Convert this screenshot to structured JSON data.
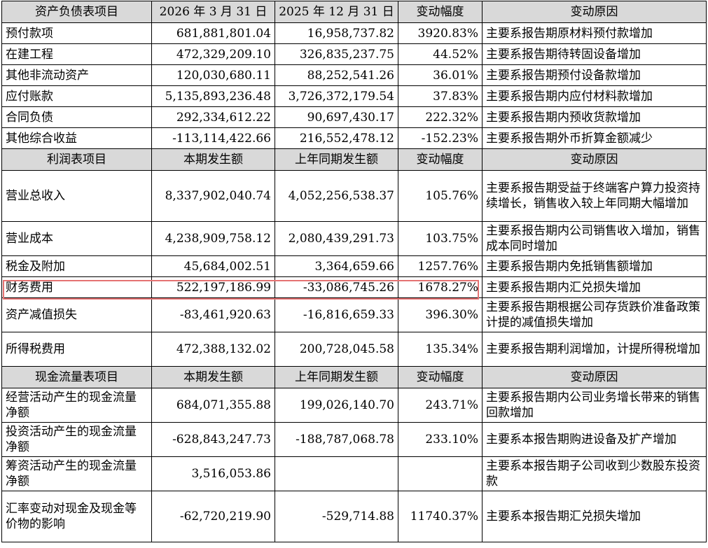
{
  "sections": {
    "balance": {
      "header": [
        "资产负债表项目",
        "2026 年 3 月 31 日",
        "2025 年 12 月 31 日",
        "变动幅度",
        "变动原因"
      ],
      "rows": [
        {
          "item": "预付款项",
          "a": "681,881,801.04",
          "b": "16,958,737.82",
          "pct": "3920.83%",
          "reason": "主要系报告期原材料预付款增加"
        },
        {
          "item": "在建工程",
          "a": "472,329,209.10",
          "b": "326,835,237.75",
          "pct": "44.52%",
          "reason": "主要系报告期待转固设备增加"
        },
        {
          "item": "其他非流动资产",
          "a": "120,030,680.11",
          "b": "88,252,541.26",
          "pct": "36.01%",
          "reason": "主要系报告期预付设备款增加"
        },
        {
          "item": "应付账款",
          "a": "5,135,893,236.48",
          "b": "3,726,372,179.54",
          "pct": "37.83%",
          "reason": "主要系报告期内应付材料款增加"
        },
        {
          "item": "合同负债",
          "a": "292,334,612.22",
          "b": "90,697,430.17",
          "pct": "222.32%",
          "reason": "主要系报告期内预收货款增加"
        },
        {
          "item": "其他综合收益",
          "a": "-113,114,422.66",
          "b": "216,552,478.12",
          "pct": "-152.23%",
          "reason": "主要系报告期外币折算金额减少"
        }
      ]
    },
    "income": {
      "header": [
        "利润表项目",
        "本期发生额",
        "上年同期发生额",
        "变动幅度",
        "变动原因"
      ],
      "rows": [
        {
          "item": "营业总收入",
          "a": "8,337,902,040.74",
          "b": "4,052,256,538.37",
          "pct": "105.76%",
          "reason": "主要系报告期受益于终端客户算力投资持续增长，销售收入较上年同期大幅增加"
        },
        {
          "item": "营业成本",
          "a": "4,238,909,758.12",
          "b": "2,080,439,291.73",
          "pct": "103.75%",
          "reason": "主要系报告期内公司销售收入增加，销售成本同时增加"
        },
        {
          "item": "税金及附加",
          "a": "45,684,002.51",
          "b": "3,364,659.66",
          "pct": "1257.76%",
          "reason": "主要系报告期内免抵销售额增加"
        },
        {
          "item": "财务费用",
          "a": "522,197,186.99",
          "b": "-33,086,745.26",
          "pct": "1678.27%",
          "reason": "主要系报告期内汇兑损失增加"
        },
        {
          "item": "资产减值损失",
          "a": "-83,461,920.63",
          "b": "-16,816,659.33",
          "pct": "396.30%",
          "reason": "主要系报告期根据公司存货跌价准备政策计提的减值损失增加"
        },
        {
          "item": "所得税费用",
          "a": "472,388,132.02",
          "b": "200,728,045.58",
          "pct": "135.34%",
          "reason": "主要系报告期利润增加，计提所得税增加"
        }
      ]
    },
    "cashflow": {
      "header": [
        "现金流量表项目",
        "本期发生额",
        "上年同期发生额",
        "变动幅度",
        "变动原因"
      ],
      "rows": [
        {
          "item": "经营活动产生的现金流量净额",
          "a": "684,071,355.88",
          "b": "199,026,140.70",
          "pct": "243.71%",
          "reason": "主要系报告期内公司业务增长带来的销售回款增加"
        },
        {
          "item": "投资活动产生的现金流量净额",
          "a": "-628,843,247.73",
          "b": "-188,787,068.78",
          "pct": "233.10%",
          "reason": "主要系本报告期购进设备及扩产增加"
        },
        {
          "item": "筹资活动产生的现金流量净额",
          "a": "3,516,053.86",
          "b": "",
          "pct": "",
          "reason": "主要系本报告期子公司收到少数股东投资款"
        },
        {
          "item": "汇率变动对现金及现金等价物的影响",
          "a": "-62,720,219.90",
          "b": "-529,714.88",
          "pct": "11740.37%",
          "reason": "主要系本报告期汇兑损失增加"
        }
      ]
    }
  }
}
